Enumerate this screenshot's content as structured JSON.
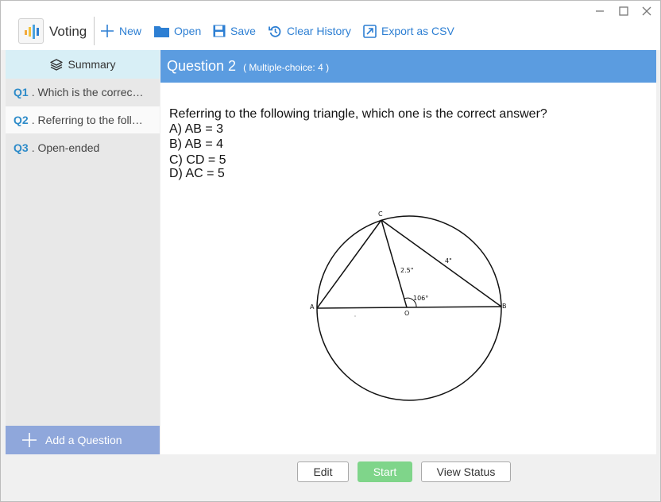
{
  "app": {
    "title": "Voting"
  },
  "toolbar": {
    "new_label": "New",
    "open_label": "Open",
    "save_label": "Save",
    "clear_history_label": "Clear History",
    "export_label": "Export as CSV"
  },
  "sidebar": {
    "summary_label": "Summary",
    "items": [
      {
        "num": "Q1",
        "text": ". Which is the correct ..."
      },
      {
        "num": "Q2",
        "text": ". Referring to the follo..."
      },
      {
        "num": "Q3",
        "text": ". Open-ended"
      }
    ],
    "add_label": "Add a Question"
  },
  "question": {
    "title": "Question 2",
    "type": "( Multiple-choice: 4 )",
    "prompt": "Referring to the following triangle, which one is the correct answer?",
    "options": [
      "A) AB = 3",
      "B) AB = 4",
      "C) CD = 5",
      "D) AC = 5"
    ],
    "diagram": {
      "label_c": "C",
      "label_a": "A",
      "label_b": "B",
      "label_o": "O",
      "label_oc": "2.5\"",
      "label_cb": "4\"",
      "label_angle": "106°"
    }
  },
  "bottom": {
    "edit_label": "Edit",
    "start_label": "Start",
    "view_status_label": "View Status"
  },
  "colors": {
    "accent": "#2d7fd3",
    "header": "#5b9ce0",
    "start": "#7fd58a",
    "add_question": "#8fa7db",
    "summary_tab": "#d8eff6"
  }
}
